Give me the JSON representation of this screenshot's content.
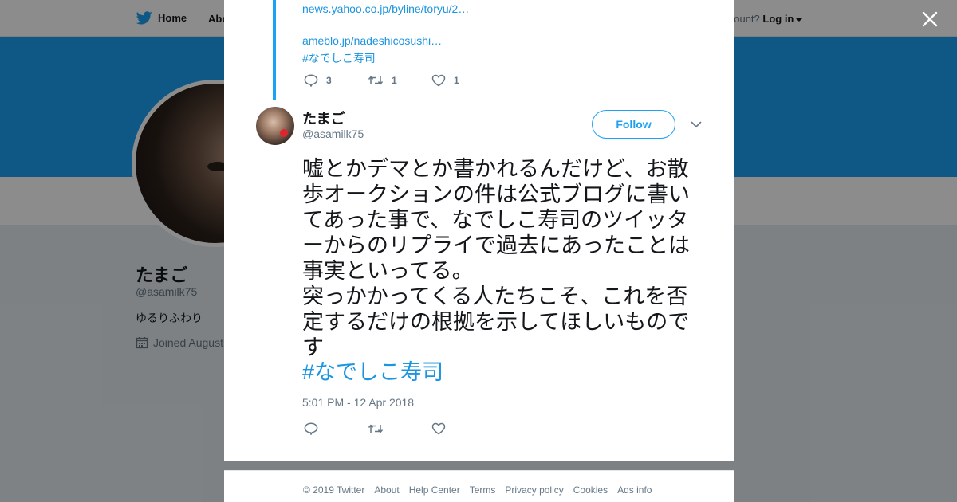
{
  "background_page": {
    "nav": {
      "home_label": "Home",
      "about_label": "About",
      "account_prompt": "account?",
      "login_label": "Log in"
    },
    "profile": {
      "name": "たまご",
      "handle": "@asamilk75",
      "bio": "ゆるりふわり",
      "joined": "Joined August"
    }
  },
  "modal": {
    "previous_tweet": {
      "links": [
        "news.yahoo.co.jp/byline/toryu/2…",
        "ameblo.jp/nadeshicosushi…"
      ],
      "hashtag": "#なでしこ寿司",
      "reply_count": "3",
      "retweet_count": "1",
      "like_count": "1"
    },
    "tweet": {
      "author_name": "たまご",
      "author_handle": "@asamilk75",
      "follow_label": "Follow",
      "text": "嘘とかデマとか書かれるんだけど、お散歩オークションの件は公式ブログに書いてあった事で、なでしこ寿司のツイッターからのリプライで過去にあったことは事実といってる。\n突っかかってくる人たちこそ、これを否定するだけの根拠を示してほしいものです",
      "hashtag": "#なでしこ寿司",
      "timestamp": "5:01 PM - 12 Apr 2018"
    }
  },
  "footer": {
    "links": [
      "© 2019 Twitter",
      "About",
      "Help Center",
      "Terms",
      "Privacy policy",
      "Cookies",
      "Ads info"
    ]
  },
  "colors": {
    "accent": "#1da1f2",
    "link": "#1b95e0",
    "text": "#14171a",
    "muted": "#657786",
    "overlay": "rgba(0,0,0,0.45)"
  },
  "icons": [
    "twitter-bird-icon",
    "calendar-icon",
    "close-icon",
    "reply-icon",
    "retweet-icon",
    "like-icon",
    "chevron-down-icon"
  ]
}
